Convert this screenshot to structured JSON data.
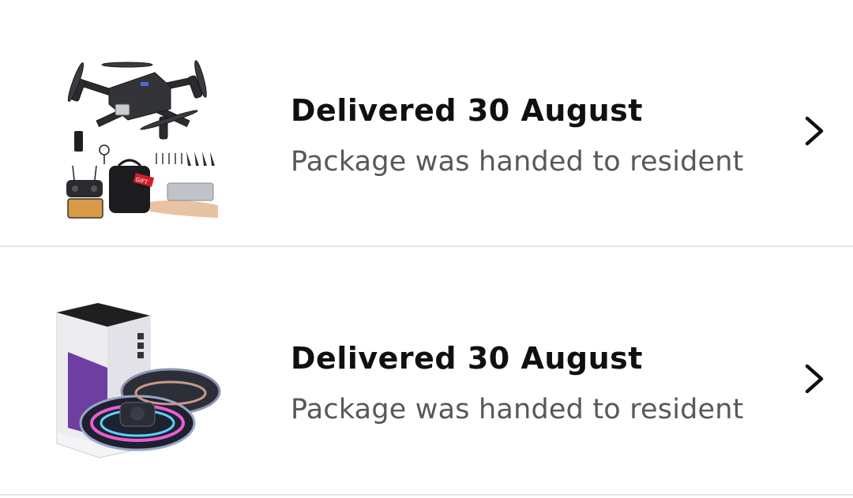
{
  "orders": [
    {
      "item": "drone-kit",
      "status_title": "Delivered 30 August",
      "status_detail": "Package was handed to resident",
      "chevron_icon": "chevron-right-icon",
      "gift_tag": "GIFT"
    },
    {
      "item": "flying-spinner-ball",
      "status_title": "Delivered 30 August",
      "status_detail": "Package was handed to resident",
      "chevron_icon": "chevron-right-icon"
    }
  ],
  "colors": {
    "title": "#0f1111",
    "subtitle": "#565959",
    "divider": "#e3e6e6",
    "chevron": "#0f1111"
  }
}
